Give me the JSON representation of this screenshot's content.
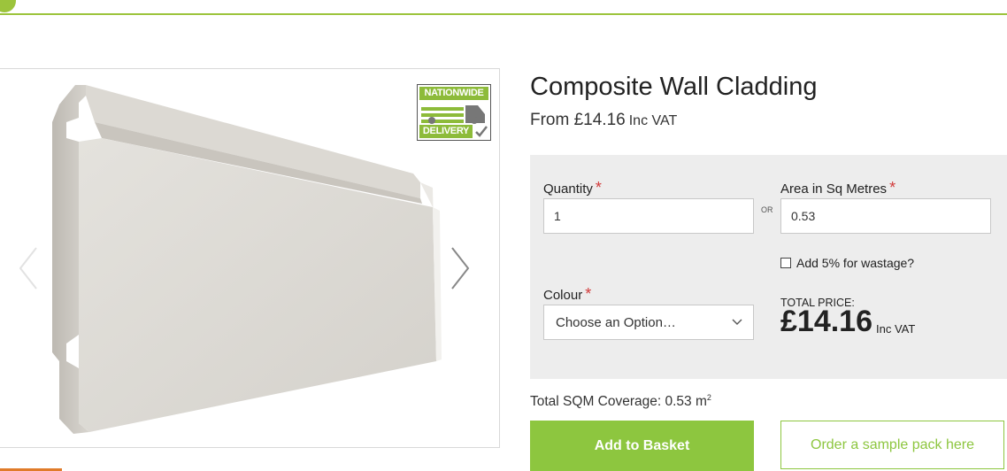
{
  "product": {
    "title": "Composite Wall Cladding",
    "from_price": "From £14.16",
    "from_vat": "Inc VAT"
  },
  "badge": {
    "line1": "NATIONWIDE",
    "line2": "DELIVERY",
    "icon": "delivery-truck-icon"
  },
  "gallery": {
    "prev_icon": "chevron-left-icon",
    "next_icon": "chevron-right-icon"
  },
  "form": {
    "quantity_label": "Quantity",
    "quantity_value": "1",
    "required_mark": "*",
    "or_label": "OR",
    "area_label": "Area in Sq Metres",
    "area_value": "0.53",
    "wastage_label": "Add 5% for wastage?",
    "colour_label": "Colour",
    "colour_selected": "Choose an Option…",
    "total_label": "TOTAL PRICE:",
    "total_price": "£14.16",
    "total_vat": "Inc VAT"
  },
  "coverage": {
    "text": "Total SQM Coverage: 0.53 m",
    "unit_sup": "2"
  },
  "buttons": {
    "add_to_basket": "Add to Basket",
    "order_sample": "Order a sample pack here"
  },
  "colors": {
    "accent_green": "#8dc63f",
    "required_red": "#d23b3b",
    "panel_grey": "#ededed"
  }
}
